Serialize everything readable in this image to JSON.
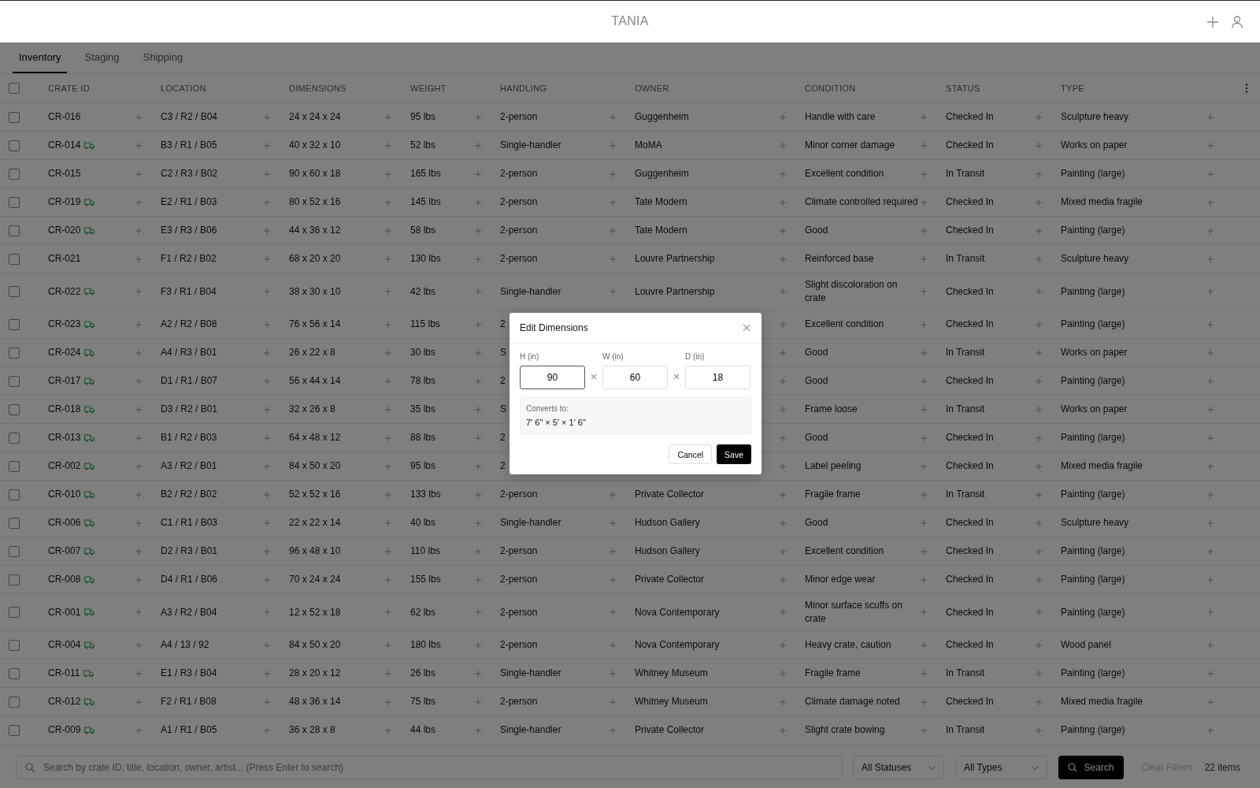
{
  "header": {
    "title": "TANIA"
  },
  "tabs": [
    {
      "label": "Inventory",
      "selected": true
    },
    {
      "label": "Staging",
      "selected": false
    },
    {
      "label": "Shipping",
      "selected": false
    }
  ],
  "table": {
    "select_all": {
      "checked": false
    },
    "columns": [
      "CRATE ID",
      "LOCATION",
      "DIMENSIONS",
      "WEIGHT",
      "HANDLING",
      "OWNER",
      "CONDITION",
      "STATUS",
      "TYPE"
    ],
    "rows": [
      {
        "checked": false,
        "shipping": false,
        "id": "CR-016",
        "location": "C3 / R2 / B04",
        "dimensions": "24 x 24 x 24",
        "weight": "95 lbs",
        "handling": "2-person",
        "owner": "Guggenheim",
        "condition": "Handle with care",
        "status": "Checked In",
        "type": "Sculpture heavy"
      },
      {
        "checked": false,
        "shipping": true,
        "id": "CR-014",
        "location": "B3 / R1 / B05",
        "dimensions": "40 x 32 x 10",
        "weight": "52 lbs",
        "handling": "Single-handler",
        "owner": "MoMA",
        "condition": "Minor corner damage",
        "status": "Checked In",
        "type": "Works on paper"
      },
      {
        "checked": false,
        "shipping": false,
        "id": "CR-015",
        "location": "C2 / R3 / B02",
        "dimensions": "90 x 60 x 18",
        "weight": "165 lbs",
        "handling": "2-person",
        "owner": "Guggenheim",
        "condition": "Excellent condition",
        "status": "In Transit",
        "type": "Painting (large)"
      },
      {
        "checked": false,
        "shipping": true,
        "id": "CR-019",
        "location": "E2 / R1 / B03",
        "dimensions": "80 x 52 x 16",
        "weight": "145 lbs",
        "handling": "2-person",
        "owner": "Tate Modern",
        "condition": "Climate controlled required",
        "status": "Checked In",
        "type": "Mixed media fragile"
      },
      {
        "checked": false,
        "shipping": true,
        "id": "CR-020",
        "location": "E3 / R3 / B06",
        "dimensions": "44 x 36 x 12",
        "weight": "58 lbs",
        "handling": "2-person",
        "owner": "Tate Modern",
        "condition": "Good",
        "status": "Checked In",
        "type": "Painting (large)"
      },
      {
        "checked": false,
        "shipping": false,
        "id": "CR-021",
        "location": "F1 / R2 / B02",
        "dimensions": "68 x 20 x 20",
        "weight": "130 lbs",
        "handling": "2-person",
        "owner": "Louvre Partnership",
        "condition": "Reinforced base",
        "status": "In Transit",
        "type": "Sculpture heavy"
      },
      {
        "checked": false,
        "shipping": true,
        "id": "CR-022",
        "location": "F3 / R1 / B04",
        "dimensions": "38 x 30 x 10",
        "weight": "42 lbs",
        "handling": "Single-handler",
        "owner": "Louvre Partnership",
        "condition": "Slight discoloration on crate",
        "status": "Checked In",
        "type": "Painting (large)"
      },
      {
        "checked": false,
        "shipping": true,
        "id": "CR-023",
        "location": "A2 / R2 / B08",
        "dimensions": "76 x 56 x 14",
        "weight": "115 lbs",
        "handling": "2",
        "condition": "Excellent condition",
        "status": "Checked In",
        "type": "Painting (large)"
      },
      {
        "checked": false,
        "shipping": true,
        "id": "CR-024",
        "location": "A4 / R3 / B01",
        "dimensions": "26 x 22 x 8",
        "weight": "30 lbs",
        "handling": "S",
        "condition": "Good",
        "status": "In Transit",
        "type": "Works on paper"
      },
      {
        "checked": false,
        "shipping": true,
        "id": "CR-017",
        "location": "D1 / R1 / B07",
        "dimensions": "56 x 44 x 14",
        "weight": "78 lbs",
        "handling": "2",
        "condition": "Good",
        "status": "Checked In",
        "type": "Painting (large)"
      },
      {
        "checked": false,
        "shipping": true,
        "id": "CR-018",
        "location": "D3 / R2 / B01",
        "dimensions": "32 x 26 x 8",
        "weight": "35 lbs",
        "handling": "S",
        "condition": "Frame loose",
        "status": "In Transit",
        "type": "Works on paper"
      },
      {
        "checked": false,
        "shipping": true,
        "id": "CR-013",
        "location": "B1 / R2 / B03",
        "dimensions": "64 x 48 x 12",
        "weight": "88 lbs",
        "handling": "2",
        "condition": "Good",
        "status": "Checked In",
        "type": "Painting (large)"
      },
      {
        "checked": false,
        "shipping": true,
        "id": "CR-002",
        "location": "A3 / R2 / B01",
        "dimensions": "84 x 50 x 20",
        "weight": "95 lbs",
        "handling": "2",
        "condition": "Label peeling",
        "status": "Checked In",
        "type": "Mixed media fragile"
      },
      {
        "checked": false,
        "shipping": true,
        "id": "CR-010",
        "location": "B2 / R2 / B02",
        "dimensions": "52 x 52 x 16",
        "weight": "133 lbs",
        "handling": "2-person",
        "owner": "Private Collector",
        "condition": "Fragile frame",
        "status": "In Transit",
        "type": "Painting (large)"
      },
      {
        "checked": false,
        "shipping": true,
        "id": "CR-006",
        "location": "C1 / R1 / B03",
        "dimensions": "22 x 22 x 14",
        "weight": "40 lbs",
        "handling": "Single-handler",
        "owner": "Hudson Gallery",
        "condition": "Good",
        "status": "Checked In",
        "type": "Sculpture heavy"
      },
      {
        "checked": false,
        "shipping": true,
        "id": "CR-007",
        "location": "D2 / R3 / B01",
        "dimensions": "96 x 48 x 10",
        "weight": "110 lbs",
        "handling": "2-person",
        "owner": "Hudson Gallery",
        "condition": "Excellent condition",
        "status": "Checked In",
        "type": "Painting (large)"
      },
      {
        "checked": false,
        "shipping": true,
        "id": "CR-008",
        "location": "D4 / R1 / B06",
        "dimensions": "70 x 24 x 24",
        "weight": "155 lbs",
        "handling": "2-person",
        "owner": "Private Collector",
        "condition": "Minor edge wear",
        "status": "Checked In",
        "type": "Painting (large)"
      },
      {
        "checked": false,
        "shipping": true,
        "id": "CR-001",
        "location": "A3 / R2 / B04",
        "dimensions": "12 x 52 x 18",
        "weight": "62 lbs",
        "handling": "2-person",
        "owner": "Nova Contemporary",
        "condition": "Minor surface scuffs on crate",
        "status": "Checked In",
        "type": "Painting (large)"
      },
      {
        "checked": false,
        "shipping": true,
        "id": "CR-004",
        "location": "A4 / 13 / 92",
        "dimensions": "84 x 50 x 20",
        "weight": "180 lbs",
        "handling": "2-person",
        "owner": "Nova Contemporary",
        "condition": "Heavy crate, caution",
        "status": "Checked In",
        "type": "Wood panel"
      },
      {
        "checked": false,
        "shipping": true,
        "id": "CR-011",
        "location": "E1 / R3 / B04",
        "dimensions": "28 x 20 x 12",
        "weight": "26 lbs",
        "handling": "Single-handler",
        "owner": "Whitney Museum",
        "condition": "Fragile frame",
        "status": "In Transit",
        "type": "Painting (large)"
      },
      {
        "checked": false,
        "shipping": true,
        "id": "CR-012",
        "location": "F2 / R1 / B08",
        "dimensions": "48 x 36 x 14",
        "weight": "75 lbs",
        "handling": "2-person",
        "owner": "Whitney Museum",
        "condition": "Climate damage noted",
        "status": "Checked In",
        "type": "Mixed media fragile"
      },
      {
        "checked": false,
        "shipping": true,
        "id": "CR-009",
        "location": "A1 / R1 / B05",
        "dimensions": "36 x 28 x 8",
        "weight": "44 lbs",
        "handling": "Single-handler",
        "owner": "Private Collector",
        "condition": "Slight crate bowing",
        "status": "In Transit",
        "type": "Painting (large)"
      }
    ]
  },
  "filter_bar": {
    "search": {
      "placeholder": "Search by crate ID, title, location, owner, artist... (Press Enter to search)"
    },
    "status_filter": "All Statuses",
    "type_filter": "All Types",
    "search_button": "Search",
    "clear_button": {
      "label": "Clear Filters",
      "disabled": true
    },
    "count": "22 items"
  },
  "modal": {
    "title": "Edit Dimensions",
    "fields": [
      {
        "label": "H (in)",
        "value": "90",
        "focused": true
      },
      {
        "label": "W (in)",
        "value": "60",
        "focused": false
      },
      {
        "label": "D (in)",
        "value": "18",
        "focused": false
      }
    ],
    "converts_label": "Converts to:",
    "converts_value": "7' 6\" × 5' × 1' 6\"",
    "buttons": {
      "cancel": "Cancel",
      "save": "Save"
    }
  }
}
